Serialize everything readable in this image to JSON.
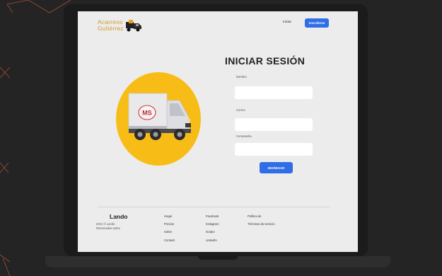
{
  "header": {
    "logo_line1": "Acarreos",
    "logo_line2": "Gutiérrez",
    "login_link": "Iniciar",
    "signup_button": "Inscribirse"
  },
  "illustration": {
    "truck_brand": "MS"
  },
  "form": {
    "title": "INICIAR SESIÓN",
    "name_label": "Nombre",
    "email_label": "Correo",
    "password_label": "Contraseña",
    "name_value": "",
    "email_value": "",
    "password_value": "",
    "submit_button": "INGRESAR"
  },
  "footer": {
    "brand": "Lando",
    "copyright_line1": "2021 © Lando",
    "copyright_line2": "Reservados todos",
    "col1": [
      "Hogar",
      "Precios",
      "Sobre",
      "Contacti"
    ],
    "col2": [
      "Facebook",
      "Instagram",
      "Gorjeo",
      "LinkedIn"
    ],
    "col3": [
      "Política de",
      "Términos de servicio"
    ]
  },
  "colors": {
    "accent": "#2f6ee6",
    "illustration_circle": "#f7bd16",
    "logo": "#d39a2b",
    "screen_bg": "#ececec",
    "desk_bg": "#242424"
  },
  "icons": [
    "truck-icon"
  ]
}
